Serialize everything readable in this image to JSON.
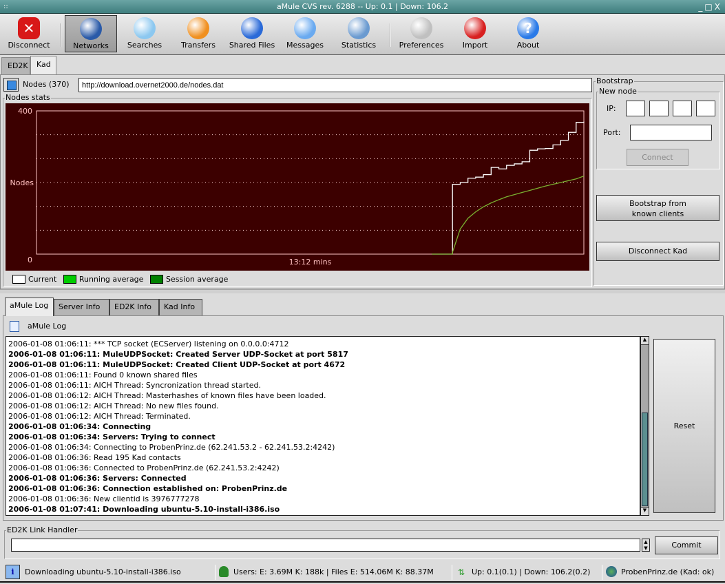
{
  "window": {
    "title": "aMule CVS rev. 6288 -- Up: 0.1 | Down: 106.2"
  },
  "toolbar": {
    "items": [
      {
        "label": "Disconnect",
        "icon": "disconnect-icon",
        "color": "#d81818",
        "active": false
      },
      {
        "label": "Networks",
        "icon": "globe-icon",
        "color": "#2a5aa8",
        "active": true
      },
      {
        "label": "Searches",
        "icon": "magnifier-icon",
        "color": "#8cc8f0",
        "active": false
      },
      {
        "label": "Transfers",
        "icon": "transfer-arrows-icon",
        "color": "#f09020",
        "active": false
      },
      {
        "label": "Shared Files",
        "icon": "file-cabinet-icon",
        "color": "#2a6ad8",
        "active": false
      },
      {
        "label": "Messages",
        "icon": "person-icon",
        "color": "#6aaaf0",
        "active": false
      },
      {
        "label": "Statistics",
        "icon": "clock-icon",
        "color": "#6a9ad0",
        "active": false
      },
      {
        "label": "Preferences",
        "icon": "tools-icon",
        "color": "#c0c0c0",
        "active": false
      },
      {
        "label": "Import",
        "icon": "import-arrows-icon",
        "color": "#d82020",
        "active": false
      },
      {
        "label": "About",
        "icon": "help-icon",
        "color": "#2a7ae8",
        "active": false
      }
    ]
  },
  "network_tabs": [
    {
      "label": "ED2K",
      "selected": false
    },
    {
      "label": "Kad",
      "selected": true
    }
  ],
  "kad": {
    "nodes_label": "Nodes (370)",
    "nodes_url": "http://download.overnet2000.de/nodes.dat",
    "stats_title": "Nodes stats"
  },
  "chart_data": {
    "type": "line",
    "title": "Nodes stats",
    "xlabel": "13:12 mins",
    "ylabel": "Nodes",
    "ylim": [
      0,
      400
    ],
    "y_ticks": [
      "400",
      "0"
    ],
    "grid": true,
    "gridlines": 5,
    "legend_position": "bottom-left",
    "x": [
      0,
      5,
      10,
      12,
      15,
      20,
      25,
      30,
      35,
      40,
      45,
      50,
      55,
      60,
      65,
      70,
      75,
      80,
      85,
      90,
      95,
      100
    ],
    "series": [
      {
        "name": "Current",
        "color": "#ffffff",
        "values": [
          0,
          0,
          0,
          0,
          195,
          200,
          212,
          215,
          222,
          242,
          238,
          248,
          252,
          258,
          290,
          294,
          295,
          305,
          318,
          340,
          368,
          370
        ]
      },
      {
        "name": "Running average",
        "color": "#00cc00",
        "values": [
          0,
          0,
          0,
          0,
          5,
          70,
          100,
          118,
          132,
          143,
          152,
          160,
          166,
          172,
          178,
          184,
          190,
          195,
          200,
          205,
          210,
          218
        ]
      },
      {
        "name": "Session average",
        "color": "#008000",
        "values": []
      }
    ],
    "legend": [
      {
        "label": "Current",
        "color": "#ffffff"
      },
      {
        "label": "Running average",
        "color": "#00cc00"
      },
      {
        "label": "Session average",
        "color": "#008000"
      }
    ]
  },
  "bootstrap": {
    "title": "Bootstrap",
    "new_node_title": "New node",
    "ip_label": "IP:",
    "ip_values": [
      "",
      "",
      "",
      ""
    ],
    "port_label": "Port:",
    "port_value": "",
    "connect_label": "Connect",
    "bootstrap_known_label_1": "Bootstrap from",
    "bootstrap_known_label_2": "known clients",
    "disconnect_kad_label": "Disconnect Kad"
  },
  "log_tabs": [
    {
      "label": "aMule Log",
      "selected": true
    },
    {
      "label": "Server Info",
      "selected": false
    },
    {
      "label": "ED2K Info",
      "selected": false
    },
    {
      "label": "Kad Info",
      "selected": false
    }
  ],
  "log": {
    "header": "aMule Log",
    "reset_label": "Reset",
    "lines": [
      {
        "text": "2006-01-08 01:06:11: *** TCP socket (ECServer) listening on 0.0.0.0:4712",
        "bold": false
      },
      {
        "text": "2006-01-08 01:06:11: MuleUDPSocket: Created Server UDP-Socket at port 5817",
        "bold": true
      },
      {
        "text": "2006-01-08 01:06:11: MuleUDPSocket: Created Client UDP-Socket at port 4672",
        "bold": true
      },
      {
        "text": "2006-01-08 01:06:11: Found 0 known shared files",
        "bold": false
      },
      {
        "text": "2006-01-08 01:06:11: AICH Thread: Syncronization thread started.",
        "bold": false
      },
      {
        "text": "2006-01-08 01:06:12: AICH Thread: Masterhashes of known files have been loaded.",
        "bold": false
      },
      {
        "text": "2006-01-08 01:06:12: AICH Thread: No new files found.",
        "bold": false
      },
      {
        "text": "2006-01-08 01:06:12: AICH Thread: Terminated.",
        "bold": false
      },
      {
        "text": "2006-01-08 01:06:34: Connecting",
        "bold": true
      },
      {
        "text": "2006-01-08 01:06:34: Servers: Trying to connect",
        "bold": true
      },
      {
        "text": "2006-01-08 01:06:34: Connecting to ProbenPrinz.de (62.241.53.2 - 62.241.53.2:4242)",
        "bold": false
      },
      {
        "text": "2006-01-08 01:06:36: Read 195 Kad contacts",
        "bold": false
      },
      {
        "text": "2006-01-08 01:06:36: Connected to ProbenPrinz.de (62.241.53.2:4242)",
        "bold": false
      },
      {
        "text": "2006-01-08 01:06:36: Servers: Connected",
        "bold": true
      },
      {
        "text": "2006-01-08 01:06:36: Connection established on: ProbenPrinz.de",
        "bold": true
      },
      {
        "text": "2006-01-08 01:06:36: New clientid is 3976777278",
        "bold": false
      },
      {
        "text": "2006-01-08 01:07:41: Downloading ubuntu-5.10-install-i386.iso",
        "bold": true
      }
    ]
  },
  "link_handler": {
    "title": "ED2K Link Handler",
    "value": "",
    "commit_label": "Commit"
  },
  "status": {
    "message": "Downloading ubuntu-5.10-install-i386.iso",
    "users_files": "Users: E: 3.69M K: 188k | Files E: 514.06M K: 88.37M",
    "speed": "Up: 0.1(0.1) | Down: 106.2(0.2)",
    "server": "ProbenPrinz.de (Kad: ok)"
  }
}
